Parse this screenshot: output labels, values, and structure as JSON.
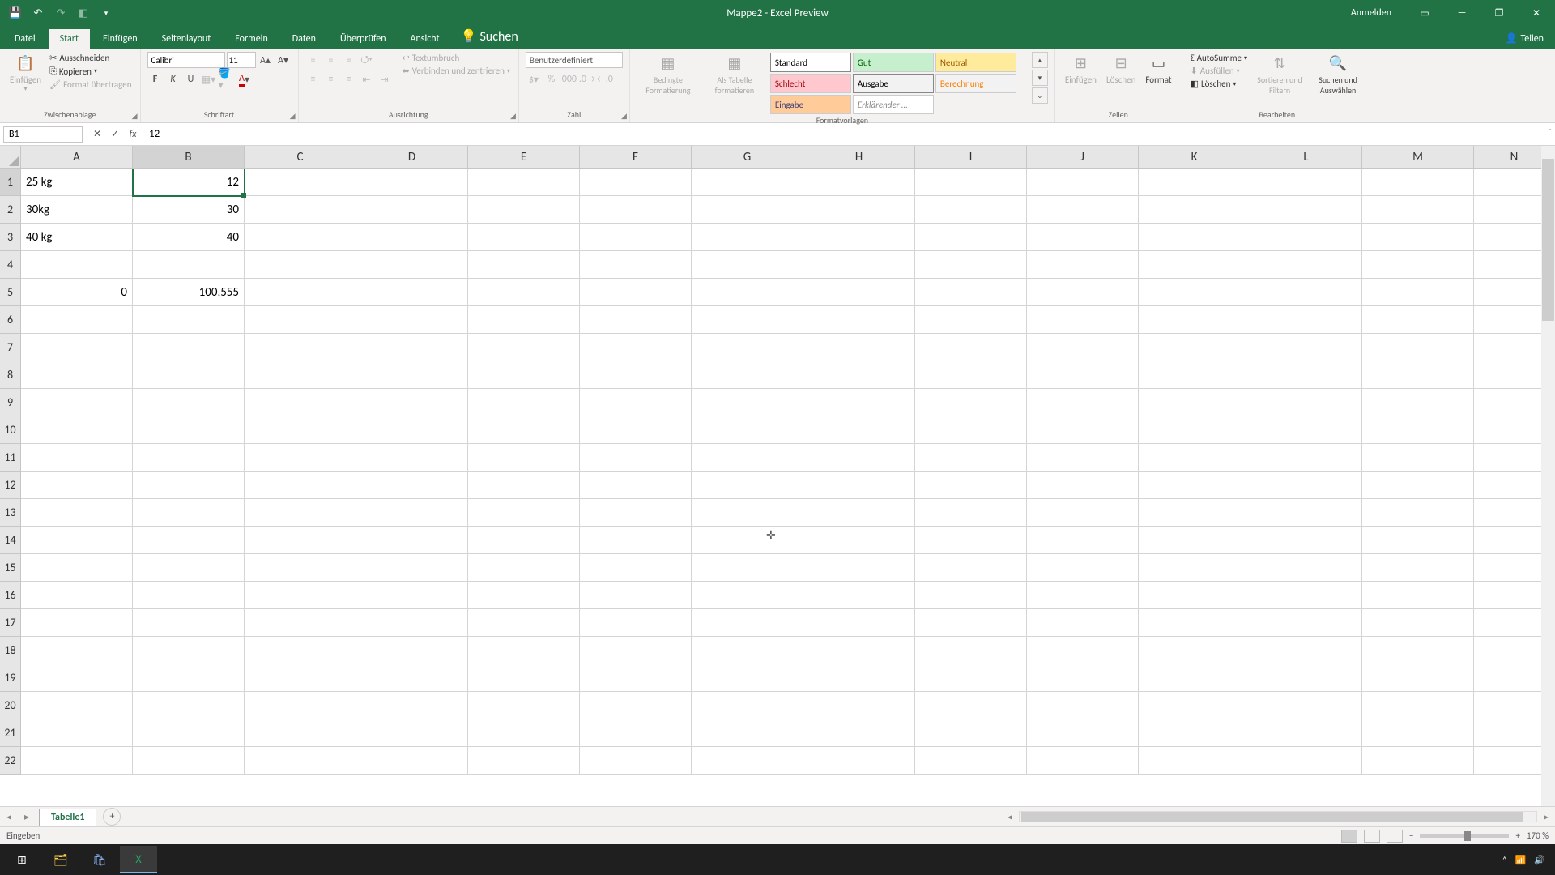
{
  "titlebar": {
    "title": "Mappe2 - Excel Preview",
    "login": "Anmelden"
  },
  "tabs": {
    "file": "Datei",
    "home": "Start",
    "insert": "Einfügen",
    "pagelayout": "Seitenlayout",
    "formulas": "Formeln",
    "data": "Daten",
    "review": "Überprüfen",
    "view": "Ansicht",
    "search": "Suchen",
    "share": "Teilen"
  },
  "ribbon": {
    "paste": "Einfügen",
    "cut": "Ausschneiden",
    "copy": "Kopieren",
    "formatpainter": "Format übertragen",
    "clipboard": "Zwischenablage",
    "font_name": "Calibri",
    "font_size": "11",
    "font_group": "Schriftart",
    "align_group": "Ausrichtung",
    "wrap": "Textumbruch",
    "merge": "Verbinden und zentrieren",
    "numfmt": "Benutzerdefiniert",
    "number_group": "Zahl",
    "cond": "Bedingte Formatierung",
    "astable": "Als Tabelle formatieren",
    "styles_group": "Formatvorlagen",
    "style_standard": "Standard",
    "style_gut": "Gut",
    "style_neutral": "Neutral",
    "style_schlecht": "Schlecht",
    "style_ausgabe": "Ausgabe",
    "style_berechnung": "Berechnung",
    "style_eingabe": "Eingabe",
    "style_erk": "Erklärender …",
    "insert_btn": "Einfügen",
    "delete_btn": "Löschen",
    "format_btn": "Format",
    "cells_group": "Zellen",
    "autosum": "AutoSumme",
    "fill": "Ausfüllen",
    "clear": "Löschen",
    "sort": "Sortieren und Filtern",
    "find": "Suchen und Auswählen",
    "editing_group": "Bearbeiten"
  },
  "formulabar": {
    "name": "B1",
    "value": "12"
  },
  "columns": [
    "A",
    "B",
    "C",
    "D",
    "E",
    "F",
    "G",
    "H",
    "I",
    "J",
    "K",
    "L",
    "M",
    "N"
  ],
  "rows": [
    "1",
    "2",
    "3",
    "4",
    "5",
    "6",
    "7",
    "8",
    "9",
    "10",
    "11",
    "12",
    "13",
    "14",
    "15",
    "16",
    "17",
    "18",
    "19",
    "20",
    "21",
    "22"
  ],
  "cells": {
    "A1": "25 kg",
    "B1": "12",
    "A2": "30kg",
    "B2": "30",
    "A3": "40 kg",
    "B3": "40",
    "A5": "0",
    "B5": "100,555"
  },
  "active_col": "B",
  "active_row": "1",
  "sheet": {
    "tab1": "Tabelle1"
  },
  "status": {
    "mode": "Eingeben",
    "zoom": "170 %"
  }
}
